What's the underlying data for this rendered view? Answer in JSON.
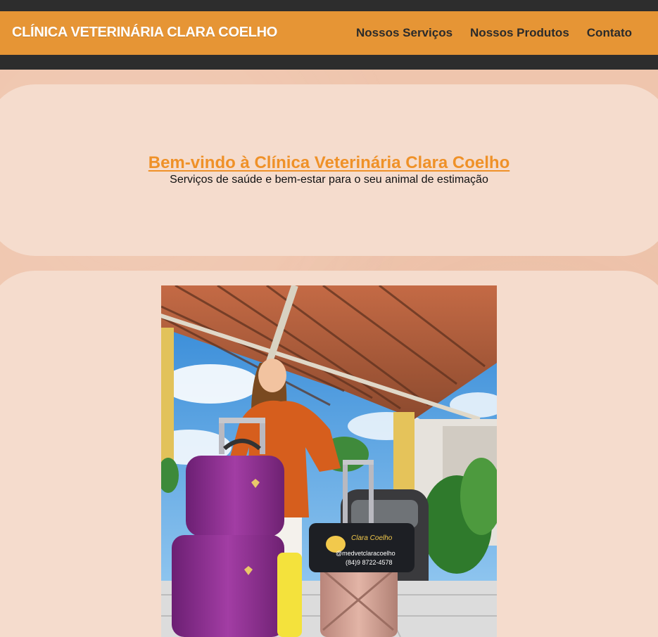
{
  "header": {
    "brand": "CLÍNICA VETERINÁRIA CLARA COELHO",
    "nav": [
      {
        "label": "Nossos Serviços"
      },
      {
        "label": "Nossos Produtos"
      },
      {
        "label": "Contato"
      }
    ]
  },
  "hero": {
    "title": "Bem-vindo à Clínica Veterinária Clara Coelho",
    "subtitle": "Serviços de saúde e bem-estar para o seu animal de estimação"
  },
  "photo": {
    "bag_name": "Clara Coelho",
    "bag_handle": "@medvetclaracoelho",
    "bag_phone": "(84)9 8722-4578"
  },
  "colors": {
    "topbar": "#2d2d2d",
    "nav_background": "#e69535",
    "accent": "#ef9128",
    "panel": "#f5dccd",
    "page": "#efc5ad"
  }
}
